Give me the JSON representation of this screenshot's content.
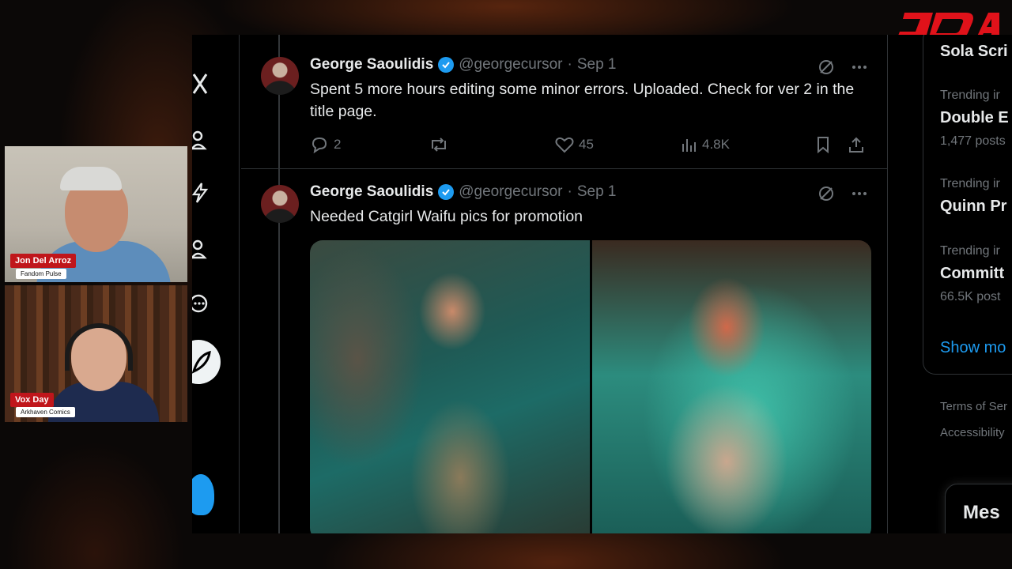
{
  "branding": {
    "logo_text": "JDA",
    "accent": "#e0121a"
  },
  "webcams": [
    {
      "name": "Jon Del Arroz",
      "subtitle": "Fandom Pulse"
    },
    {
      "name": "Vox Day",
      "subtitle": "Arkhaven Comics"
    }
  ],
  "tweets": [
    {
      "display_name": "George Saoulidis",
      "handle": "@georgecursor",
      "separator": "·",
      "date": "Sep 1",
      "text": "Spent 5 more hours editing some minor errors. Uploaded. Check for ver 2 in the title page.",
      "replies": "2",
      "likes": "45",
      "views": "4.8K"
    },
    {
      "display_name": "George Saoulidis",
      "handle": "@georgecursor",
      "separator": "·",
      "date": "Sep 1",
      "text": "Needed Catgirl Waifu pics for promotion"
    }
  ],
  "sidebar": {
    "heading": "Sola Scri",
    "trends": [
      {
        "label": "Trending ir",
        "topic": "Double E",
        "count": "1,477 posts"
      },
      {
        "label": "Trending ir",
        "topic": "Quinn Pr",
        "count": ""
      },
      {
        "label": "Trending ir",
        "topic": "Committ",
        "count": "66.5K post"
      }
    ],
    "show_more": "Show mo",
    "footer_links": [
      "Terms of Ser",
      "Accessibility"
    ],
    "messages_label": "Mes"
  },
  "colors": {
    "link_blue": "#1d9bf0",
    "muted": "#71767b",
    "border": "#2f3336"
  },
  "icons": [
    "grok-icon",
    "more-icon",
    "reply-icon",
    "repost-icon",
    "like-icon",
    "views-icon",
    "bookmark-icon",
    "share-icon",
    "verified-badge-icon"
  ]
}
